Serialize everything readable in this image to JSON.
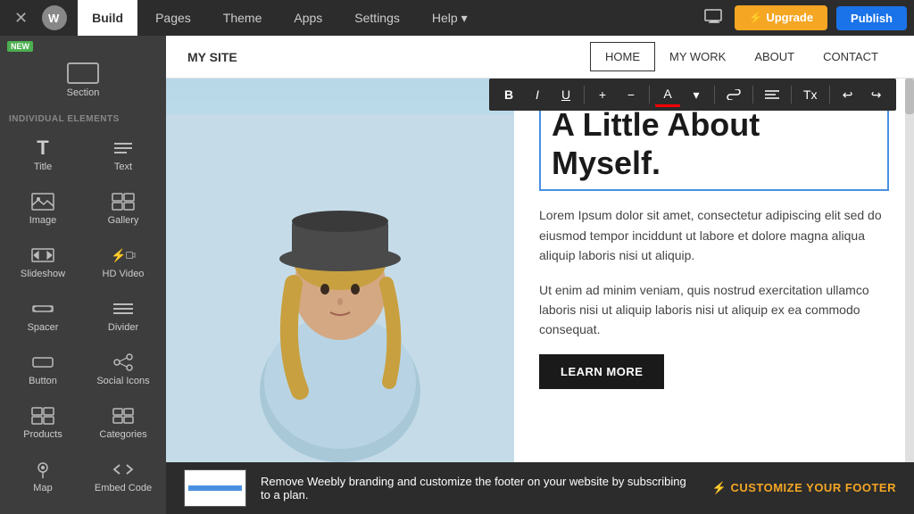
{
  "topnav": {
    "tabs": [
      {
        "label": "Build",
        "active": true
      },
      {
        "label": "Pages",
        "active": false
      },
      {
        "label": "Theme",
        "active": false
      },
      {
        "label": "Apps",
        "active": false
      },
      {
        "label": "Settings",
        "active": false
      },
      {
        "label": "Help ▾",
        "active": false
      }
    ],
    "upgrade_label": "⚡ Upgrade",
    "publish_label": "Publish"
  },
  "sidebar": {
    "new_badge": "NEW",
    "section_label": "Section",
    "individual_elements_label": "INDIVIDUAL ELEMENTS",
    "items": [
      {
        "id": "title",
        "label": "Title",
        "icon": "T"
      },
      {
        "id": "text",
        "label": "Text",
        "icon": "≡"
      },
      {
        "id": "image",
        "label": "Image",
        "icon": "🖼"
      },
      {
        "id": "gallery",
        "label": "Gallery",
        "icon": "⊞"
      },
      {
        "id": "slideshow",
        "label": "Slideshow",
        "icon": "⊟"
      },
      {
        "id": "hd-video",
        "label": "HD Video",
        "icon": "▶",
        "lightning": true
      },
      {
        "id": "spacer",
        "label": "Spacer",
        "icon": "↔"
      },
      {
        "id": "divider",
        "label": "Divider",
        "icon": "÷"
      },
      {
        "id": "button",
        "label": "Button",
        "icon": "▬"
      },
      {
        "id": "social-icons",
        "label": "Social Icons",
        "icon": "⋈"
      },
      {
        "id": "products",
        "label": "Products",
        "icon": "⊞"
      },
      {
        "id": "categories",
        "label": "Categories",
        "icon": "⊟"
      },
      {
        "id": "map",
        "label": "Map",
        "icon": "📍"
      },
      {
        "id": "embed-code",
        "label": "Embed Code",
        "icon": "</>"
      }
    ]
  },
  "site_header": {
    "title": "MY SITE",
    "nav_items": [
      {
        "label": "HOME",
        "active": true
      },
      {
        "label": "MY WORK",
        "active": false
      },
      {
        "label": "ABOUT",
        "active": false
      },
      {
        "label": "CONTACT",
        "active": false
      }
    ]
  },
  "edit_toolbar": {
    "buttons": [
      "B",
      "I",
      "U",
      "+",
      "−",
      "A",
      "🔗",
      "≡",
      "Tx",
      "↩",
      "↪"
    ]
  },
  "canvas": {
    "heading": "A Little About\nMyself.",
    "body_paragraph_1": "Lorem Ipsum dolor sit amet, consectetur adipiscing elit sed do eiusmod tempor inciddunt ut labore et dolore magna aliqua aliquip laboris nisi ut aliquip.",
    "body_paragraph_2": "Ut enim ad minim veniam, quis nostrud exercitation ullamco laboris nisi ut aliquip laboris nisi ut aliquip ex ea commodo consequat.",
    "learn_more_label": "LEARN MORE"
  },
  "footer_banner": {
    "text": "Remove Weebly branding and customize the footer on your website by subscribing to a plan.",
    "customize_label": "⚡  CUSTOMIZE YOUR FOOTER"
  }
}
